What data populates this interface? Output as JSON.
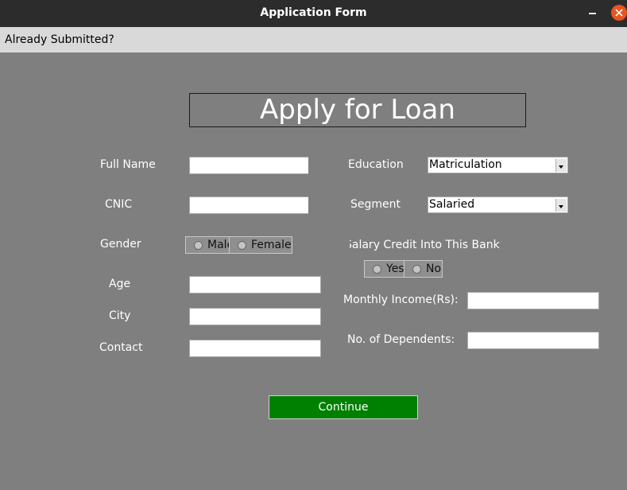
{
  "window": {
    "title": "Application Form"
  },
  "menu": {
    "already_submitted": "Already Submitted?"
  },
  "heading": "Apply for Loan",
  "left": {
    "full_name_label": "Full Name",
    "cnic_label": "CNIC",
    "gender_label": "Gender",
    "gender_options": [
      "Male",
      "Female"
    ],
    "age_label": "Age",
    "city_label": "City",
    "contact_label": "Contact"
  },
  "right": {
    "education_label": "Education",
    "education_value": "Matriculation",
    "segment_label": "Segment",
    "segment_value": "Salaried",
    "salary_credit_label": "Salary Credit Into This Bank",
    "salary_credit_options": [
      "Yes",
      "No"
    ],
    "monthly_income_label": "Monthly Income(Rs):",
    "dependents_label": "No. of Dependents:"
  },
  "continue_label": "Continue",
  "colors": {
    "accent": "#008000",
    "close_button": "#e95420",
    "background": "#7f7f7f"
  }
}
